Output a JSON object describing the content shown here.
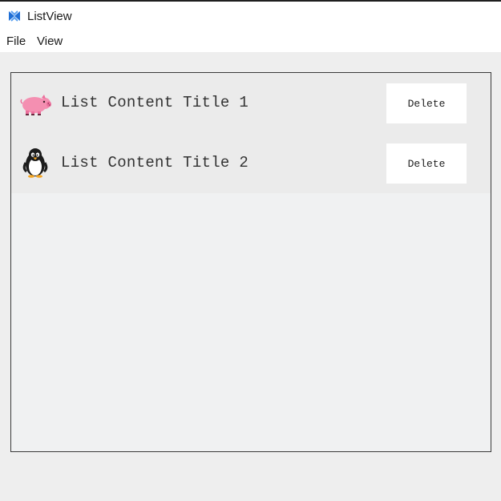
{
  "window": {
    "title": "ListView",
    "app_icon": "maui-logo-icon",
    "accent": "#1f6fd6"
  },
  "menu": {
    "items": [
      {
        "label": "File"
      },
      {
        "label": "View"
      }
    ]
  },
  "list": {
    "items": [
      {
        "icon": "pig-icon",
        "title": "List Content Title 1",
        "action_label": "Delete"
      },
      {
        "icon": "penguin-icon",
        "title": "List Content Title 2",
        "action_label": "Delete"
      }
    ]
  }
}
